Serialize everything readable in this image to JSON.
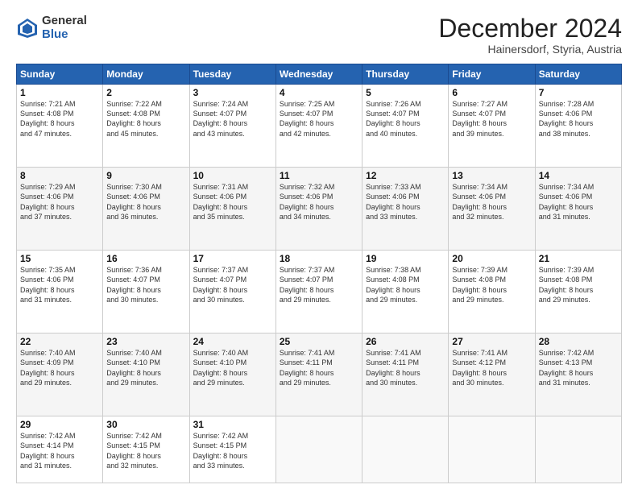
{
  "header": {
    "logo_general": "General",
    "logo_blue": "Blue",
    "month_title": "December 2024",
    "location": "Hainersdorf, Styria, Austria"
  },
  "days_of_week": [
    "Sunday",
    "Monday",
    "Tuesday",
    "Wednesday",
    "Thursday",
    "Friday",
    "Saturday"
  ],
  "weeks": [
    [
      {
        "day": "1",
        "lines": [
          "Sunrise: 7:21 AM",
          "Sunset: 4:08 PM",
          "Daylight: 8 hours",
          "and 47 minutes."
        ]
      },
      {
        "day": "2",
        "lines": [
          "Sunrise: 7:22 AM",
          "Sunset: 4:08 PM",
          "Daylight: 8 hours",
          "and 45 minutes."
        ]
      },
      {
        "day": "3",
        "lines": [
          "Sunrise: 7:24 AM",
          "Sunset: 4:07 PM",
          "Daylight: 8 hours",
          "and 43 minutes."
        ]
      },
      {
        "day": "4",
        "lines": [
          "Sunrise: 7:25 AM",
          "Sunset: 4:07 PM",
          "Daylight: 8 hours",
          "and 42 minutes."
        ]
      },
      {
        "day": "5",
        "lines": [
          "Sunrise: 7:26 AM",
          "Sunset: 4:07 PM",
          "Daylight: 8 hours",
          "and 40 minutes."
        ]
      },
      {
        "day": "6",
        "lines": [
          "Sunrise: 7:27 AM",
          "Sunset: 4:07 PM",
          "Daylight: 8 hours",
          "and 39 minutes."
        ]
      },
      {
        "day": "7",
        "lines": [
          "Sunrise: 7:28 AM",
          "Sunset: 4:06 PM",
          "Daylight: 8 hours",
          "and 38 minutes."
        ]
      }
    ],
    [
      {
        "day": "8",
        "lines": [
          "Sunrise: 7:29 AM",
          "Sunset: 4:06 PM",
          "Daylight: 8 hours",
          "and 37 minutes."
        ]
      },
      {
        "day": "9",
        "lines": [
          "Sunrise: 7:30 AM",
          "Sunset: 4:06 PM",
          "Daylight: 8 hours",
          "and 36 minutes."
        ]
      },
      {
        "day": "10",
        "lines": [
          "Sunrise: 7:31 AM",
          "Sunset: 4:06 PM",
          "Daylight: 8 hours",
          "and 35 minutes."
        ]
      },
      {
        "day": "11",
        "lines": [
          "Sunrise: 7:32 AM",
          "Sunset: 4:06 PM",
          "Daylight: 8 hours",
          "and 34 minutes."
        ]
      },
      {
        "day": "12",
        "lines": [
          "Sunrise: 7:33 AM",
          "Sunset: 4:06 PM",
          "Daylight: 8 hours",
          "and 33 minutes."
        ]
      },
      {
        "day": "13",
        "lines": [
          "Sunrise: 7:34 AM",
          "Sunset: 4:06 PM",
          "Daylight: 8 hours",
          "and 32 minutes."
        ]
      },
      {
        "day": "14",
        "lines": [
          "Sunrise: 7:34 AM",
          "Sunset: 4:06 PM",
          "Daylight: 8 hours",
          "and 31 minutes."
        ]
      }
    ],
    [
      {
        "day": "15",
        "lines": [
          "Sunrise: 7:35 AM",
          "Sunset: 4:06 PM",
          "Daylight: 8 hours",
          "and 31 minutes."
        ]
      },
      {
        "day": "16",
        "lines": [
          "Sunrise: 7:36 AM",
          "Sunset: 4:07 PM",
          "Daylight: 8 hours",
          "and 30 minutes."
        ]
      },
      {
        "day": "17",
        "lines": [
          "Sunrise: 7:37 AM",
          "Sunset: 4:07 PM",
          "Daylight: 8 hours",
          "and 30 minutes."
        ]
      },
      {
        "day": "18",
        "lines": [
          "Sunrise: 7:37 AM",
          "Sunset: 4:07 PM",
          "Daylight: 8 hours",
          "and 29 minutes."
        ]
      },
      {
        "day": "19",
        "lines": [
          "Sunrise: 7:38 AM",
          "Sunset: 4:08 PM",
          "Daylight: 8 hours",
          "and 29 minutes."
        ]
      },
      {
        "day": "20",
        "lines": [
          "Sunrise: 7:39 AM",
          "Sunset: 4:08 PM",
          "Daylight: 8 hours",
          "and 29 minutes."
        ]
      },
      {
        "day": "21",
        "lines": [
          "Sunrise: 7:39 AM",
          "Sunset: 4:08 PM",
          "Daylight: 8 hours",
          "and 29 minutes."
        ]
      }
    ],
    [
      {
        "day": "22",
        "lines": [
          "Sunrise: 7:40 AM",
          "Sunset: 4:09 PM",
          "Daylight: 8 hours",
          "and 29 minutes."
        ]
      },
      {
        "day": "23",
        "lines": [
          "Sunrise: 7:40 AM",
          "Sunset: 4:10 PM",
          "Daylight: 8 hours",
          "and 29 minutes."
        ]
      },
      {
        "day": "24",
        "lines": [
          "Sunrise: 7:40 AM",
          "Sunset: 4:10 PM",
          "Daylight: 8 hours",
          "and 29 minutes."
        ]
      },
      {
        "day": "25",
        "lines": [
          "Sunrise: 7:41 AM",
          "Sunset: 4:11 PM",
          "Daylight: 8 hours",
          "and 29 minutes."
        ]
      },
      {
        "day": "26",
        "lines": [
          "Sunrise: 7:41 AM",
          "Sunset: 4:11 PM",
          "Daylight: 8 hours",
          "and 30 minutes."
        ]
      },
      {
        "day": "27",
        "lines": [
          "Sunrise: 7:41 AM",
          "Sunset: 4:12 PM",
          "Daylight: 8 hours",
          "and 30 minutes."
        ]
      },
      {
        "day": "28",
        "lines": [
          "Sunrise: 7:42 AM",
          "Sunset: 4:13 PM",
          "Daylight: 8 hours",
          "and 31 minutes."
        ]
      }
    ],
    [
      {
        "day": "29",
        "lines": [
          "Sunrise: 7:42 AM",
          "Sunset: 4:14 PM",
          "Daylight: 8 hours",
          "and 31 minutes."
        ]
      },
      {
        "day": "30",
        "lines": [
          "Sunrise: 7:42 AM",
          "Sunset: 4:15 PM",
          "Daylight: 8 hours",
          "and 32 minutes."
        ]
      },
      {
        "day": "31",
        "lines": [
          "Sunrise: 7:42 AM",
          "Sunset: 4:15 PM",
          "Daylight: 8 hours",
          "and 33 minutes."
        ]
      },
      null,
      null,
      null,
      null
    ]
  ]
}
